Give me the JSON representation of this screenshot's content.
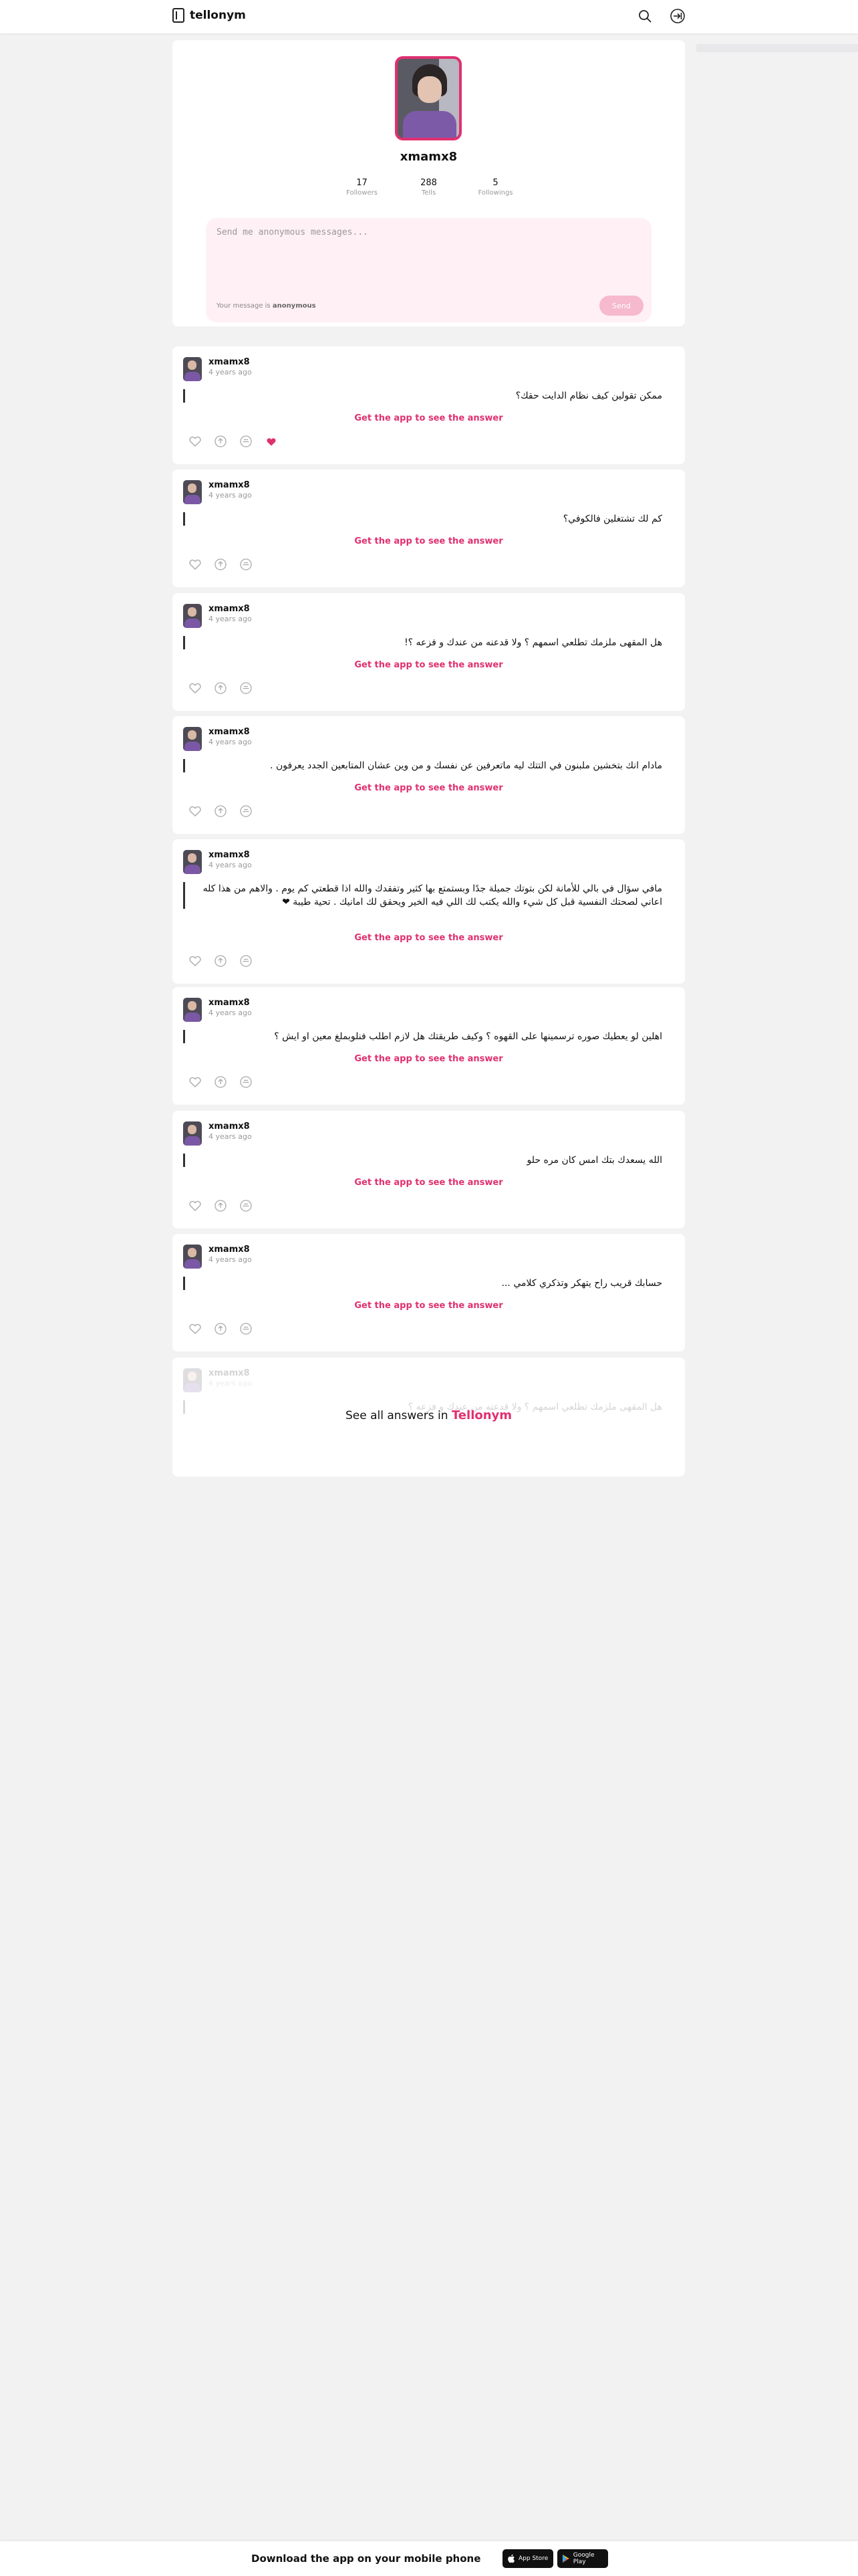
{
  "header": {
    "logo": "tellonym"
  },
  "profile": {
    "username": "xmamx8",
    "stats": [
      {
        "value": "17",
        "label": "Followers"
      },
      {
        "value": "288",
        "label": "Tells"
      },
      {
        "value": "5",
        "label": "Followings"
      }
    ],
    "message_placeholder": "Send me anonymous messages...",
    "note_prefix": "Your message is ",
    "note_bold": "anonymous",
    "send_label": "Send"
  },
  "questions": [
    {
      "user": "xmamx8",
      "time": "4 years ago",
      "text": "ممكن تقولين كيف نظام الدايت حقك؟",
      "cta": "Get the app to see the answer",
      "liked": true
    },
    {
      "user": "xmamx8",
      "time": "4 years ago",
      "text": "كم لك تشتغلين فالكوفي؟",
      "cta": "Get the app to see the answer",
      "liked": false
    },
    {
      "user": "xmamx8",
      "time": "4 years ago",
      "text": "هل المقهى ملزمك تطلعي اسمهم ؟ ولا قدعنه من عندك و فزعه ؟!",
      "cta": "Get the app to see the answer",
      "liked": false
    },
    {
      "user": "xmamx8",
      "time": "4 years ago",
      "text": "مادام انك بتخشين ملبنون في التتك ليه ماتعرفين عن نفسك و من وين عشان المتابعين الجدد يعرفون .",
      "cta": "Get the app to see the answer",
      "liked": false
    },
    {
      "user": "xmamx8",
      "time": "4 years ago",
      "text": "مافي سؤال في بالي للأمانة لكن بتوتك جميلة جدًا وبستمتع بها كثير وتفقدك والله اذا قطعتي كم يوم . والاهم من هذا كله اعاني لصحتك النفسية قبل كل شيء والله يكتب لك اللي فيه الخير ويحقق لك امانيك . تحية طيبة ❤",
      "cta": "Get the app to see the answer",
      "liked": false
    },
    {
      "user": "xmamx8",
      "time": "4 years ago",
      "text": "اهلين لو يعطيك صوره ترسمينها على القهوه ؟ وكيف طريقتك هل لازم اطلب فنلوبملغ معين او ايش ؟",
      "cta": "Get the app to see the answer",
      "liked": false
    },
    {
      "user": "xmamx8",
      "time": "4 years ago",
      "text": "الله يسعدك بتك امس كان مره حلو",
      "cta": "Get the app to see the answer",
      "liked": false
    },
    {
      "user": "xmamx8",
      "time": "4 years ago",
      "text": "حسابك قريب راح يتهكر وتذكري كلامي ...",
      "cta": "Get the app to see the answer",
      "liked": false
    }
  ],
  "faded": {
    "user": "xmamx8",
    "time": "4 years ago",
    "text": "هل المقهى ملزمك تطلعي اسمهم ؟ ولا قدعنه من عندك و فزعه ؟",
    "see_all_prefix": "See all answers in ",
    "see_all_brand": "Tellonym"
  },
  "footer": {
    "download_text": "Download the app on your mobile phone",
    "app_store": "App Store",
    "google_play": "Google Play"
  },
  "colors": {
    "accent": "#e0306f",
    "background": "#f2f2f3"
  },
  "icons": [
    "search-icon",
    "login-icon",
    "heart-icon",
    "share-icon",
    "send-icon"
  ]
}
